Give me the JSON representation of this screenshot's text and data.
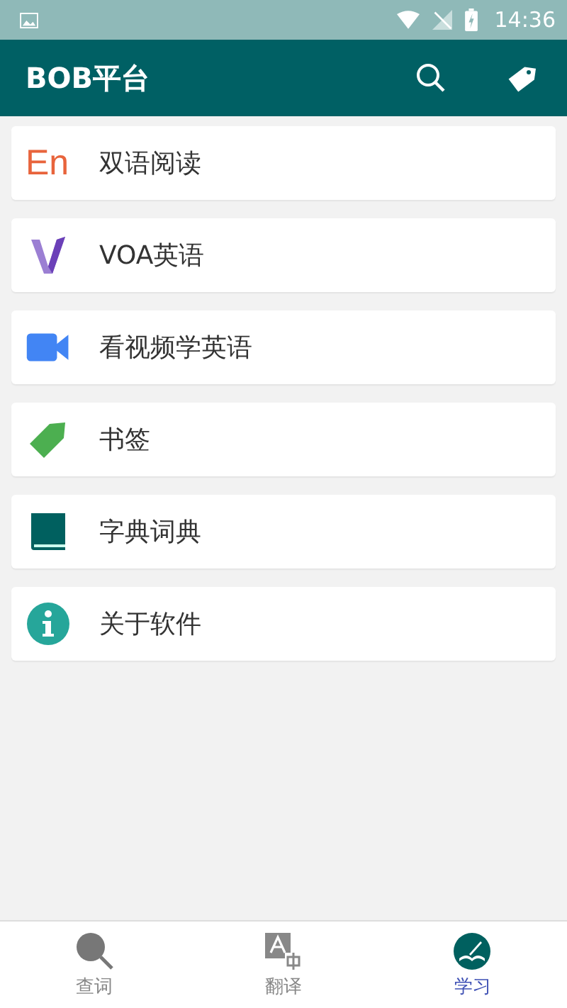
{
  "status_bar": {
    "time": "14:36"
  },
  "app_bar": {
    "title": "BOB平台"
  },
  "menu": [
    {
      "kind": "en",
      "icon_text": "En",
      "label": "双语阅读"
    },
    {
      "kind": "voa",
      "label": "VOA英语"
    },
    {
      "kind": "video",
      "label": "看视频学英语"
    },
    {
      "kind": "tag",
      "label": "书签"
    },
    {
      "kind": "book",
      "label": "字典词典"
    },
    {
      "kind": "info",
      "label": "关于软件"
    }
  ],
  "bottom_nav": [
    {
      "kind": "lookup",
      "label": "查词",
      "selected": false
    },
    {
      "kind": "translate",
      "label": "翻译",
      "selected": false
    },
    {
      "kind": "study",
      "label": "学习",
      "selected": true
    }
  ]
}
